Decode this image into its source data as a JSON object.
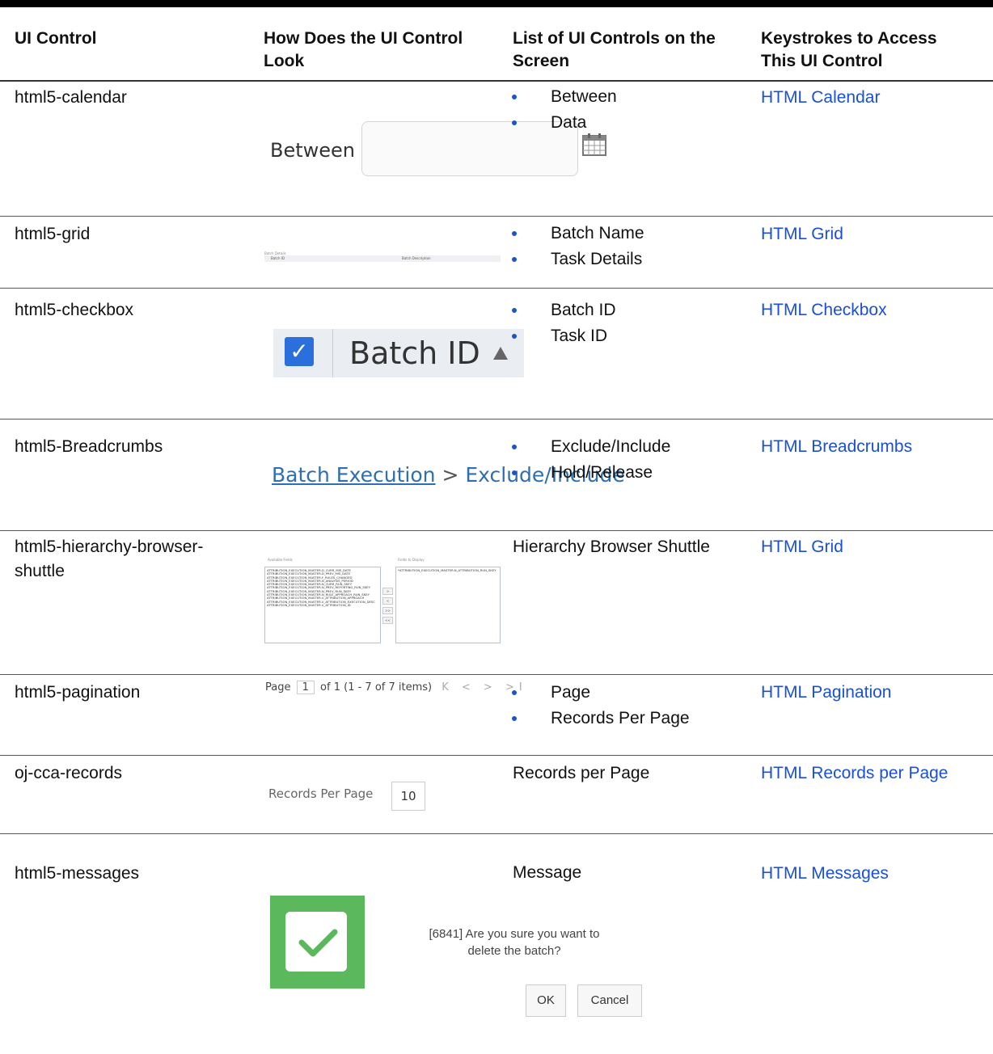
{
  "headers": {
    "col1": "UI Control",
    "col2_line1": "How Does the UI Control",
    "col2_line2": "Look",
    "col3_line1": "List of UI Controls on the",
    "col3_line2": "Screen",
    "col4_line1": "Keystrokes to Access",
    "col4_line2": "This UI Control"
  },
  "rows": [
    {
      "control": "html5-calendar",
      "items": [
        "Between",
        "Data"
      ],
      "link": "HTML Calendar"
    },
    {
      "control": "html5-grid",
      "items": [
        "Batch Name",
        "Task Details"
      ],
      "link": "HTML Grid"
    },
    {
      "control": "html5-checkbox",
      "items": [
        "Batch ID",
        "Task ID"
      ],
      "link": "HTML Checkbox"
    },
    {
      "control": "html5-Breadcrumbs",
      "items": [
        "Exclude/Include",
        "Hold/Release"
      ],
      "link": "HTML Breadcrumbs"
    },
    {
      "control_line1": "html5-hierarchy-browser-",
      "control_line2": "shuttle",
      "text": "Hierarchy Browser Shuttle",
      "link": "HTML Grid"
    },
    {
      "control": "html5-pagination",
      "items": [
        "Page",
        "Records Per Page"
      ],
      "link": "HTML Pagination"
    },
    {
      "control": "oj-cca-records",
      "text": "Records per Page",
      "link": "HTML Records per Page"
    },
    {
      "control": "html5-messages",
      "text": "Message",
      "link": "HTML Messages"
    }
  ],
  "visuals": {
    "calendar": {
      "label": "Between",
      "icon": "calendar-icon"
    },
    "grid": {
      "caption": "Batch Details",
      "col_a": "Batch ID",
      "col_b": "Batch Description"
    },
    "checkbox": {
      "label": "Batch ID",
      "check": "✓",
      "sort": "sort-ascending-icon"
    },
    "breadcrumbs": {
      "link": "Batch Execution",
      "separator": ">",
      "current": "Exclude/Include"
    },
    "shuttle": {
      "available_caption": "Available Fields",
      "display_caption": "Fields to Display",
      "available": [
        "ATTRIBUTION_EXECUTION_MASTER.D_CURR_MIS_DATE",
        "ATTRIBUTION_EXECUTION_MASTER.D_PREV_MIS_DATE",
        "ATTRIBUTION_EXECUTION_MASTER.F_RULES_CHANGED",
        "ATTRIBUTION_EXECUTION_MASTER.N_ANALYSIS_PERIOD",
        "ATTRIBUTION_EXECUTION_MASTER.N_CURR_RUN_SKEY",
        "ATTRIBUTION_EXECUTION_MASTER.N_PREV_REPORTING_RUN_SKEY",
        "ATTRIBUTION_EXECUTION_MASTER.N_PREV_RUN_SKEY",
        "ATTRIBUTION_EXECUTION_MASTER.N_RULE_APPROACH_RUN_SKEY",
        "ATTRIBUTION_EXECUTION_MASTER.V_ATTRIBUTION_APPROACH",
        "ATTRIBUTION_EXECUTION_MASTER.V_ATTRIBUTION_EXECUTION_DESC",
        "ATTRIBUTION_EXECUTION_MASTER.V_ATTRIBUTION_ID"
      ],
      "display": [
        "*ATTRIBUTION_EXECUTION_MASTER.N_ATTRIBUTION_RUN_SKEY"
      ],
      "buttons": [
        ">",
        "<",
        ">>",
        "<<"
      ]
    },
    "pagination": {
      "page_label": "Page",
      "page": "1",
      "of": "of 1",
      "range": "(1 - 7 of  7  items)",
      "nav": "K < > >I"
    },
    "records": {
      "label": "Records Per Page",
      "value": "10"
    },
    "messages": {
      "line1": "[6841] Are you sure you want to",
      "line2": "delete the batch?",
      "ok": "OK",
      "cancel": "Cancel",
      "icon": "success-check-icon"
    }
  },
  "colors": {
    "link": "#1a4fd6",
    "bullet": "#1a55cc",
    "success": "#5cb85c",
    "checkbox": "#2a6fdb"
  }
}
